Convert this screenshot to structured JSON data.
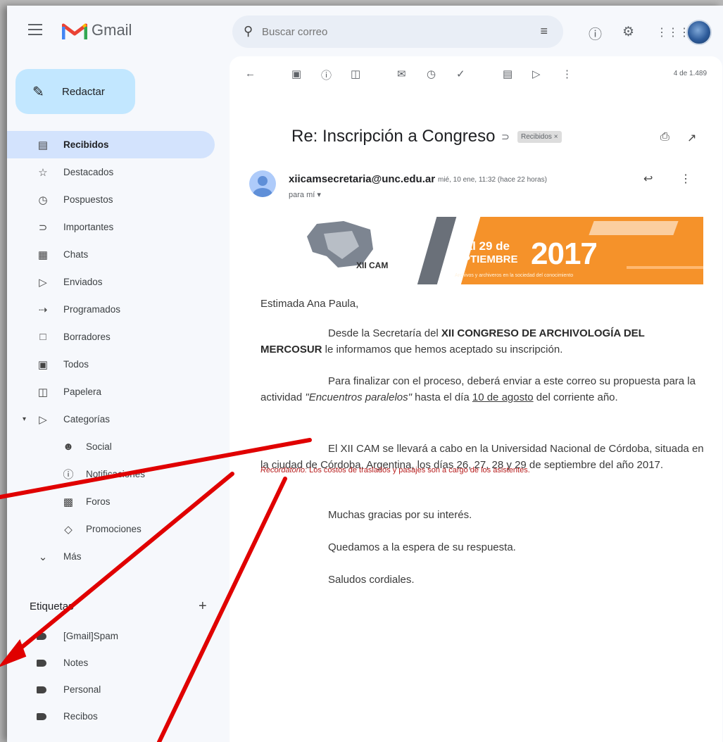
{
  "app": {
    "name": "Gmail"
  },
  "search": {
    "placeholder": "Buscar correo"
  },
  "compose": {
    "label": "Redactar"
  },
  "nav": {
    "items": [
      {
        "icon": "inbox-icon",
        "label": "Recibidos",
        "active": true
      },
      {
        "icon": "star-icon",
        "label": "Destacados"
      },
      {
        "icon": "clock-icon",
        "label": "Pospuestos"
      },
      {
        "icon": "important-icon",
        "label": "Importantes"
      },
      {
        "icon": "chat-icon",
        "label": "Chats"
      },
      {
        "icon": "send-icon",
        "label": "Enviados"
      },
      {
        "icon": "scheduled-icon",
        "label": "Programados"
      },
      {
        "icon": "draft-icon",
        "label": "Borradores"
      },
      {
        "icon": "all-mail-icon",
        "label": "Todos"
      },
      {
        "icon": "trash-icon",
        "label": "Papelera"
      },
      {
        "icon": "label-icon",
        "label": "Categorías"
      }
    ],
    "categories": [
      {
        "icon": "people-icon",
        "label": "Social"
      },
      {
        "icon": "info-icon",
        "label": "Notificaciones"
      },
      {
        "icon": "forum-icon",
        "label": "Foros"
      },
      {
        "icon": "promo-tag-icon",
        "label": "Promociones"
      }
    ],
    "more": "Más"
  },
  "labels": {
    "heading": "Etiquetas",
    "items": [
      "[Gmail]Spam",
      "Notes",
      "Personal",
      "Recibos"
    ]
  },
  "toolbar": {
    "counter": "4 de 1.489"
  },
  "message": {
    "subject": "Re: Inscripción a Congreso",
    "chip": "Recibidos ×",
    "sender": "xiicamsecretaria@unc.edu.ar",
    "datetime": "mié, 10 ene, 11:32 (hace 22 horas)",
    "to": "para mí ▾",
    "banner": {
      "brand": "XII CAM",
      "dates_line1": "26 al 29 de",
      "dates_line2": "SEPTIEMBRE",
      "year": "2017",
      "tagline": "Archivos y archiveros en la sociedad del conocimiento"
    },
    "greeting": "Estimada Ana Paula,",
    "p1_a": "Desde la Secretaría del ",
    "p1_b": "XII CONGRESO DE ARCHIVOLOGÍA DEL MERCOSUR",
    "p1_c": " le informamos que hemos aceptado su inscripción.",
    "p2_a": "Para finalizar con el proceso, deberá enviar a este correo su propuesta para la actividad ",
    "p2_b": "\"Encuentros paralelos\"",
    "p2_c": " hasta el día ",
    "p2_d": "10 de agosto",
    "p2_e": " del corriente año.",
    "p3": "El XII CAM se llevará a cabo en la Universidad Nacional de Córdoba, situada en la ciudad de Córdoba, Argentina, los días 26, 27, 28 y 29 de septiembre del año 2017.",
    "closing1": "Muchas gracias por su interés.",
    "closing2": "Quedamos a la espera de su respuesta.",
    "closing3": "Saludos cordiales.",
    "reminder_label": "Recordatorio:",
    "reminder_text": " Los costos de traslados y pasajes son a cargo de los asistentes."
  },
  "colors": {
    "compose_bg": "#c2e7ff",
    "active_nav": "#d3e3fd",
    "banner": "#f5922a",
    "annotation": "#e00000"
  }
}
